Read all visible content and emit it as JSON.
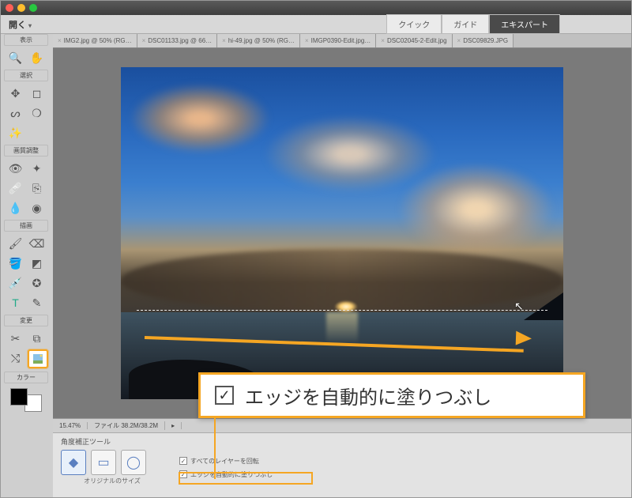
{
  "menu": {
    "open": "開く",
    "triangle": "▾"
  },
  "modes": {
    "quick": "クイック",
    "guide": "ガイド",
    "expert": "エキスパート"
  },
  "tabs": [
    "IMG2.jpg @ 50% (RG…",
    "DSC01133.jpg @ 66…",
    "hi-49.jpg @ 50% (RG…",
    "IMGP0390-Edit.jpg…",
    "DSC02045-2-Edit.jpg",
    "DSC09829.JPG"
  ],
  "sections": {
    "view": "表示",
    "select": "選択",
    "enhance": "画質調整",
    "draw": "描画",
    "modify": "変更",
    "color": "カラー"
  },
  "status": {
    "zoom": "15.47%",
    "file": "ファイル  38.2M/38.2M"
  },
  "options": {
    "title": "角度補正ツール",
    "sub_label": "オリジナルのサイズ",
    "check1": "すべてのレイヤーを回転",
    "check2": "エッジを自動的に塗りつぶし"
  },
  "callout": {
    "text": "エッジを自動的に塗りつぶし"
  }
}
